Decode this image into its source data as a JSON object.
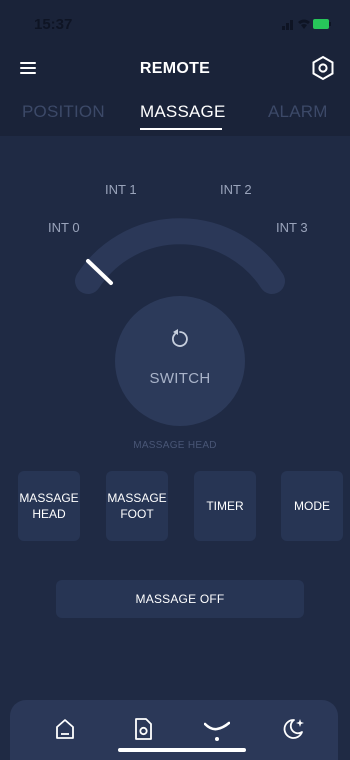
{
  "status": {
    "time": "15:37"
  },
  "header": {
    "title": "REMOTE"
  },
  "tabs": [
    {
      "label": "POSITION",
      "active": false
    },
    {
      "label": "MASSAGE",
      "active": true
    },
    {
      "label": "ALARM",
      "active": false
    }
  ],
  "dial": {
    "labels": [
      "INT 0",
      "INT 1",
      "INT 2",
      "INT 3"
    ],
    "selected": "INT 0"
  },
  "switch": {
    "label": "SWITCH"
  },
  "mode_caption": "MASSAGE HEAD",
  "function_buttons": [
    {
      "label": "MASSAGE\nHEAD"
    },
    {
      "label": "MASSAGE\nFOOT"
    },
    {
      "label": "TIMER"
    },
    {
      "label": "MODE"
    }
  ],
  "massage_off": {
    "label": "MASSAGE OFF"
  },
  "bottom_nav": {
    "items": [
      {
        "icon": "home-icon",
        "active": false
      },
      {
        "icon": "remote-icon",
        "active": false
      },
      {
        "icon": "bed-icon",
        "active": true
      },
      {
        "icon": "sleep-icon",
        "active": false
      }
    ]
  },
  "colors": {
    "background": "#1f2a44",
    "header": "#1a2339",
    "button": "#273554",
    "accent": "#ffffff"
  }
}
